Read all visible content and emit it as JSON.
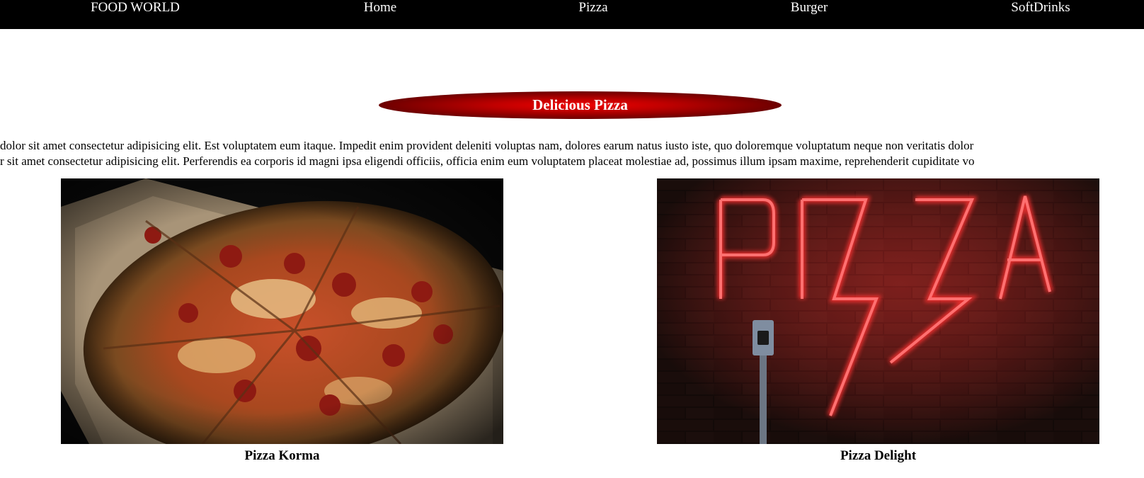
{
  "nav": {
    "brand": "FOOD WORLD",
    "items": [
      "Home",
      "Pizza",
      "Burger",
      "SoftDrinks"
    ]
  },
  "section": {
    "title": "Delicious Pizza",
    "paragraphs": [
      "dolor sit amet consectetur adipisicing elit. Est voluptatem eum itaque. Impedit enim provident deleniti voluptas nam, dolores earum natus iusto iste, quo doloremque voluptatum neque non veritatis dolor",
      "r sit amet consectetur adipisicing elit. Perferendis ea corporis id magni ipsa eligendi officiis, officia enim eum voluptatem placeat molestiae ad, possimus illum ipsam maxime, reprehenderit cupiditate vo"
    ]
  },
  "gallery": [
    {
      "caption": "Pizza Korma",
      "image": "pizza-photo"
    },
    {
      "caption": "Pizza Delight",
      "image": "neon-pizza-sign"
    }
  ],
  "colors": {
    "nav_bg": "#000000",
    "heading_red": "#e00000",
    "neon_red": "#ff2a2a"
  }
}
